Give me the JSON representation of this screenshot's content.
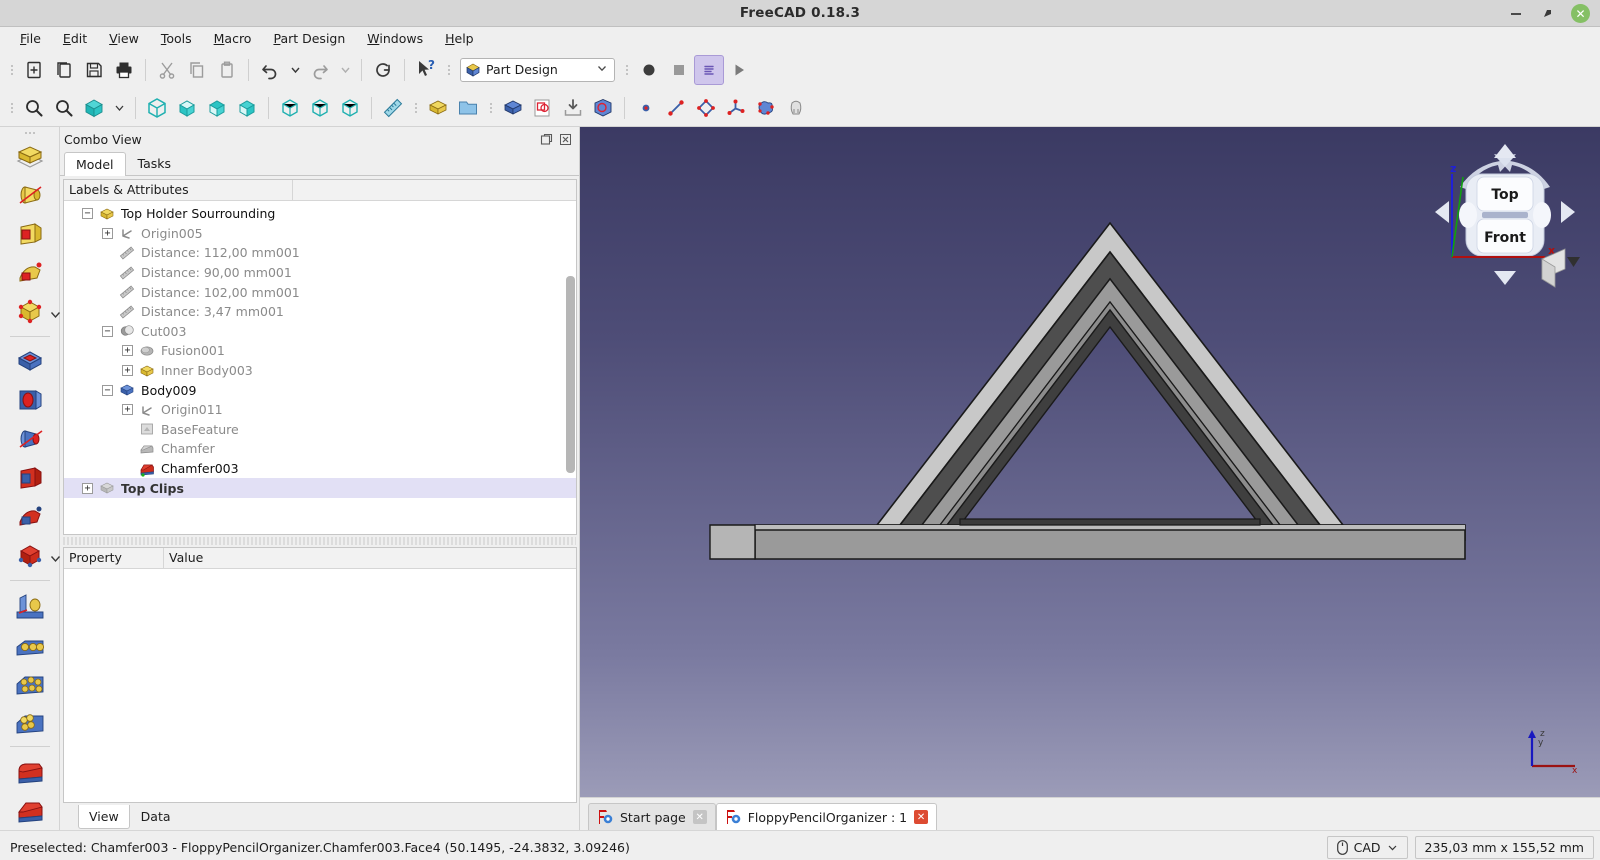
{
  "window": {
    "title": "FreeCAD 0.18.3",
    "minimize": "minimize-icon",
    "maximize": "maximize-icon",
    "close": "close-icon"
  },
  "menubar": {
    "items": [
      {
        "label": "File",
        "mnemonic": "F"
      },
      {
        "label": "Edit",
        "mnemonic": "E"
      },
      {
        "label": "View",
        "mnemonic": "V"
      },
      {
        "label": "Tools",
        "mnemonic": "T"
      },
      {
        "label": "Macro",
        "mnemonic": "M"
      },
      {
        "label": "Part Design",
        "mnemonic": "P"
      },
      {
        "label": "Windows",
        "mnemonic": "W"
      },
      {
        "label": "Help",
        "mnemonic": "H"
      }
    ]
  },
  "toolbar_file": {
    "buttons": [
      {
        "name": "new-document-icon",
        "title": "New"
      },
      {
        "name": "open-document-icon",
        "title": "Open"
      },
      {
        "name": "save-icon",
        "title": "Save"
      },
      {
        "name": "print-icon",
        "title": "Print"
      },
      {
        "name": "cut-icon",
        "title": "Cut"
      },
      {
        "name": "copy-icon",
        "title": "Copy"
      },
      {
        "name": "paste-icon",
        "title": "Paste"
      },
      {
        "name": "undo-icon",
        "title": "Undo"
      },
      {
        "name": "undo-dropdown-icon",
        "title": "Undo history"
      },
      {
        "name": "redo-icon",
        "title": "Redo"
      },
      {
        "name": "redo-dropdown-icon",
        "title": "Redo history"
      },
      {
        "name": "refresh-icon",
        "title": "Refresh"
      },
      {
        "name": "whats-this-icon",
        "title": "What's this?"
      }
    ]
  },
  "workbench": {
    "selected": "Part Design",
    "icon": "part-design-icon",
    "dropdown_icon": "chevron-down-icon"
  },
  "toolbar_macro": {
    "buttons": [
      {
        "name": "macro-record-icon",
        "title": "Macro recording"
      },
      {
        "name": "macro-stop-icon",
        "title": "Stop macro recording"
      },
      {
        "name": "macro-edit-icon",
        "title": "Macros"
      },
      {
        "name": "macro-execute-icon",
        "title": "Execute macro"
      }
    ]
  },
  "toolbar_view": {
    "buttons": [
      {
        "name": "fit-all-icon",
        "title": "Fit all"
      },
      {
        "name": "fit-selection-icon",
        "title": "Fit selection"
      },
      {
        "name": "draw-style-icon",
        "title": "Draw style"
      },
      {
        "name": "draw-style-dropdown-icon",
        "title": "Draw style menu"
      },
      {
        "name": "axonometric-view-icon",
        "title": "Isometric"
      },
      {
        "name": "front-view-icon",
        "title": "Front"
      },
      {
        "name": "top-view-icon",
        "title": "Top"
      },
      {
        "name": "right-view-icon",
        "title": "Right"
      },
      {
        "name": "rear-view-icon",
        "title": "Rear"
      },
      {
        "name": "bottom-view-icon",
        "title": "Bottom"
      },
      {
        "name": "left-view-icon",
        "title": "Left"
      },
      {
        "name": "measure-icon",
        "title": "Measure"
      },
      {
        "name": "create-part-icon",
        "title": "Create part"
      },
      {
        "name": "create-group-icon",
        "title": "Create group"
      },
      {
        "name": "create-body-icon",
        "title": "Create body"
      },
      {
        "name": "create-sketch-icon",
        "title": "Create sketch"
      },
      {
        "name": "attach-sketch-icon",
        "title": "Attach sketch"
      },
      {
        "name": "validate-sketch-icon",
        "title": "Validate sketch"
      },
      {
        "name": "create-point-icon",
        "title": "Create point"
      },
      {
        "name": "create-line-icon",
        "title": "Create line"
      },
      {
        "name": "create-polyline-icon",
        "title": "Create polyline"
      },
      {
        "name": "create-datum-icon",
        "title": "Create datum"
      },
      {
        "name": "create-surface-icon",
        "title": "Create surface"
      },
      {
        "name": "shape-binder-icon",
        "title": "Shape binder"
      }
    ]
  },
  "left_toolbar": {
    "groups": [
      {
        "name": "additive",
        "buttons": [
          {
            "name": "pad-icon",
            "title": "Pad"
          },
          {
            "name": "revolution-icon",
            "title": "Revolution"
          },
          {
            "name": "additive-loft-icon",
            "title": "Additive loft"
          },
          {
            "name": "additive-pipe-icon",
            "title": "Additive pipe"
          },
          {
            "name": "additive-primitive-icon",
            "title": "Additive primitive",
            "has_dropdown": true
          }
        ]
      },
      {
        "name": "subtractive",
        "buttons": [
          {
            "name": "pocket-icon",
            "title": "Pocket"
          },
          {
            "name": "hole-icon",
            "title": "Hole"
          },
          {
            "name": "groove-icon",
            "title": "Groove"
          },
          {
            "name": "subtractive-loft-icon",
            "title": "Subtractive loft"
          },
          {
            "name": "subtractive-pipe-icon",
            "title": "Subtractive pipe"
          },
          {
            "name": "subtractive-primitive-icon",
            "title": "Subtractive primitive",
            "has_dropdown": true
          }
        ]
      },
      {
        "name": "transform",
        "buttons": [
          {
            "name": "mirrored-icon",
            "title": "Mirrored"
          },
          {
            "name": "linear-pattern-icon",
            "title": "Linear pattern"
          },
          {
            "name": "polar-pattern-icon",
            "title": "Polar pattern"
          },
          {
            "name": "multi-transform-icon",
            "title": "Multi transform"
          }
        ]
      },
      {
        "name": "dressup",
        "buttons": [
          {
            "name": "fillet-icon",
            "title": "Fillet"
          },
          {
            "name": "chamfer-icon",
            "title": "Chamfer"
          }
        ]
      }
    ]
  },
  "combo_view": {
    "title": "Combo View",
    "float_icon": "float-panel-icon",
    "close_icon": "close-panel-icon",
    "tabs": [
      {
        "label": "Model",
        "selected": true
      },
      {
        "label": "Tasks",
        "selected": false
      }
    ],
    "tree_header": "Labels & Attributes",
    "tree": [
      {
        "label": "Top Holder Sourrounding",
        "depth": 1,
        "expander": "minus",
        "icon": "part-icon",
        "style": "black"
      },
      {
        "label": "Origin005",
        "depth": 2,
        "expander": "plus",
        "icon": "origin-icon",
        "style": "grey"
      },
      {
        "label": "Distance: 112,00 mm001",
        "depth": 2,
        "expander": "none",
        "icon": "measure-distance-icon",
        "style": "grey"
      },
      {
        "label": "Distance: 90,00 mm001",
        "depth": 2,
        "expander": "none",
        "icon": "measure-distance-icon",
        "style": "grey"
      },
      {
        "label": "Distance: 102,00 mm001",
        "depth": 2,
        "expander": "none",
        "icon": "measure-distance-icon",
        "style": "grey"
      },
      {
        "label": "Distance: 3,47 mm001",
        "depth": 2,
        "expander": "none",
        "icon": "measure-distance-icon",
        "style": "grey"
      },
      {
        "label": "Cut003",
        "depth": 2,
        "expander": "minus",
        "icon": "cut-boolean-icon",
        "style": "grey"
      },
      {
        "label": "Fusion001",
        "depth": 3,
        "expander": "plus",
        "icon": "fusion-icon",
        "style": "grey"
      },
      {
        "label": "Inner Body003",
        "depth": 3,
        "expander": "plus",
        "icon": "part-icon",
        "style": "grey"
      },
      {
        "label": "Body009",
        "depth": 2,
        "expander": "minus",
        "icon": "body-icon",
        "style": "black"
      },
      {
        "label": "Origin011",
        "depth": 3,
        "expander": "plus",
        "icon": "origin-icon",
        "style": "grey"
      },
      {
        "label": "BaseFeature",
        "depth": 3,
        "expander": "none",
        "icon": "base-feature-icon",
        "style": "grey"
      },
      {
        "label": "Chamfer",
        "depth": 3,
        "expander": "none",
        "icon": "chamfer-grey-icon",
        "style": "grey"
      },
      {
        "label": "Chamfer003",
        "depth": 3,
        "expander": "none",
        "icon": "chamfer-tip-icon",
        "style": "black"
      },
      {
        "label": "Top Clips",
        "depth": 1,
        "expander": "plus",
        "icon": "part-grey-icon",
        "style": "selected"
      }
    ],
    "property_header": {
      "property": "Property",
      "value": "Value"
    },
    "bottom_tabs": [
      {
        "label": "View",
        "selected": true
      },
      {
        "label": "Data",
        "selected": false
      }
    ]
  },
  "view3d": {
    "navcube": {
      "top_face": "Top",
      "front_face": "Front",
      "arrow_up": "arrow-up-icon",
      "arrow_down": "arrow-down-icon",
      "arrow_left": "arrow-left-icon",
      "arrow_right": "arrow-right-icon",
      "rotate_left": "rotate-left-icon",
      "rotate_right": "rotate-right-icon",
      "home_cube": "home-view-icon"
    },
    "axis_labels": {
      "x": "x",
      "y": "y",
      "z": "z"
    },
    "tabs": [
      {
        "label": "Start page",
        "icon": "freecad-doc-icon",
        "close": "close-tab-icon",
        "selected": false,
        "close_style": "grey"
      },
      {
        "label": "FloppyPencilOrganizer : 1",
        "icon": "freecad-doc-icon",
        "close": "close-tab-icon",
        "selected": true,
        "close_style": "red"
      }
    ]
  },
  "statusbar": {
    "message": "Preselected: Chamfer003 - FloppyPencilOrganizer.Chamfer003.Face4 (50.1495, -24.3832, 3.09246)",
    "nav_style": {
      "label": "CAD",
      "icon": "mouse-icon",
      "dropdown": "chevron-down-icon"
    },
    "dimensions": "235,03 mm x 155,52 mm"
  },
  "colors": {
    "accent_cyan": "#2bc4c4",
    "accent_yellow": "#e8c84a",
    "accent_blue": "#3a5fa8",
    "accent_red": "#cf2a2a",
    "selection": "#e2e0f5",
    "viewport_top": "#3b3a63",
    "viewport_bottom": "#a3a3bd",
    "model_light": "#c6c6c6",
    "model_dark": "#555555"
  }
}
